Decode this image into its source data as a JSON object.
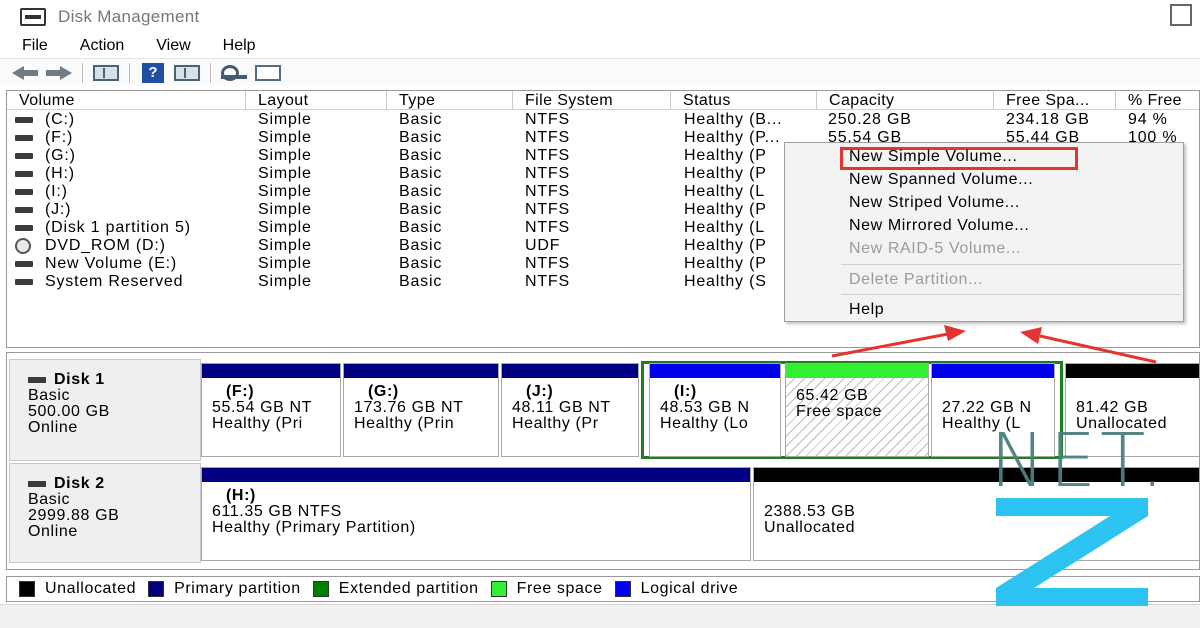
{
  "window": {
    "title": "Disk Management"
  },
  "menu": [
    "File",
    "Action",
    "View",
    "Help"
  ],
  "toolbar": {
    "buttons": [
      "back-arrow-icon",
      "forward-arrow-icon",
      "console-tree-icon",
      "help-icon",
      "properties-icon",
      "rescan-disks-icon",
      "list-view-icon"
    ],
    "help_glyph": "?"
  },
  "volume_table": {
    "columns": [
      "Volume",
      "Layout",
      "Type",
      "File System",
      "Status",
      "Capacity",
      "Free Spa...",
      "% Free"
    ],
    "rows": [
      {
        "volume": "(C:)",
        "layout": "Simple",
        "type": "Basic",
        "fs": "NTFS",
        "status": "Healthy (B...",
        "capacity": "250.28 GB",
        "free": "234.18 GB",
        "pct": "94 %"
      },
      {
        "volume": "(F:)",
        "layout": "Simple",
        "type": "Basic",
        "fs": "NTFS",
        "status": "Healthy (P...",
        "capacity": "55.54 GB",
        "free": "55.44 GB",
        "pct": "100 %"
      },
      {
        "volume": "(G:)",
        "layout": "Simple",
        "type": "Basic",
        "fs": "NTFS",
        "status": "Healthy (P",
        "capacity": "",
        "free": "",
        "pct": ""
      },
      {
        "volume": "(H:)",
        "layout": "Simple",
        "type": "Basic",
        "fs": "NTFS",
        "status": "Healthy (P",
        "capacity": "",
        "free": "",
        "pct": ""
      },
      {
        "volume": "(I:)",
        "layout": "Simple",
        "type": "Basic",
        "fs": "NTFS",
        "status": "Healthy (L",
        "capacity": "",
        "free": "",
        "pct": ""
      },
      {
        "volume": "(J:)",
        "layout": "Simple",
        "type": "Basic",
        "fs": "NTFS",
        "status": "Healthy (P",
        "capacity": "",
        "free": "",
        "pct": ""
      },
      {
        "volume": "(Disk 1 partition 5)",
        "layout": "Simple",
        "type": "Basic",
        "fs": "NTFS",
        "status": "Healthy (L",
        "capacity": "",
        "free": "",
        "pct": ""
      },
      {
        "volume": "DVD_ROM (D:)",
        "layout": "Simple",
        "type": "Basic",
        "fs": "UDF",
        "status": "Healthy (P",
        "capacity": "",
        "free": "",
        "pct": ""
      },
      {
        "volume": "New Volume (E:)",
        "layout": "Simple",
        "type": "Basic",
        "fs": "NTFS",
        "status": "Healthy (P",
        "capacity": "",
        "free": "",
        "pct": ""
      },
      {
        "volume": "System Reserved",
        "layout": "Simple",
        "type": "Basic",
        "fs": "NTFS",
        "status": "Healthy (S",
        "capacity": "",
        "free": "",
        "pct": ""
      }
    ]
  },
  "context_menu": {
    "items": [
      {
        "label": "New Simple Volume...",
        "enabled": true,
        "highlighted": true
      },
      {
        "label": "New Spanned Volume...",
        "enabled": true
      },
      {
        "label": "New Striped Volume...",
        "enabled": true
      },
      {
        "label": "New Mirrored Volume...",
        "enabled": true
      },
      {
        "label": "New RAID-5 Volume...",
        "enabled": false
      },
      {
        "label": "Delete Partition...",
        "enabled": false
      },
      {
        "label": "Help",
        "enabled": true
      }
    ]
  },
  "disks": [
    {
      "name": "Disk 1",
      "type": "Basic",
      "size": "500.00 GB",
      "state": "Online",
      "partitions": [
        {
          "name": "(F:)",
          "line1": "55.54 GB NT",
          "line2": "Healthy (Pri",
          "kind": "primary"
        },
        {
          "name": "(G:)",
          "line1": "173.76 GB NT",
          "line2": "Healthy (Prin",
          "kind": "primary"
        },
        {
          "name": "(J:)",
          "line1": "48.11 GB NT",
          "line2": "Healthy (Pr",
          "kind": "primary"
        },
        {
          "name": "(I:)",
          "line1": "48.53 GB N",
          "line2": "Healthy (Lo",
          "kind": "logical"
        },
        {
          "name": "",
          "line1": "65.42 GB",
          "line2": "Free space",
          "kind": "free"
        },
        {
          "name": "",
          "line1": "27.22 GB N",
          "line2": "Healthy (L",
          "kind": "logical"
        },
        {
          "name": "",
          "line1": "81.42 GB",
          "line2": "Unallocated",
          "kind": "unallocated"
        }
      ]
    },
    {
      "name": "Disk 2",
      "type": "Basic",
      "size": "2999.88 GB",
      "state": "Online",
      "partitions": [
        {
          "name": "(H:)",
          "line1": "611.35 GB NTFS",
          "line2": "Healthy (Primary Partition)",
          "kind": "primary"
        },
        {
          "name": "",
          "line1": "2388.53 GB",
          "line2": "Unallocated",
          "kind": "unallocated"
        }
      ]
    }
  ],
  "legend": [
    {
      "label": "Unallocated",
      "color": "#000000"
    },
    {
      "label": "Primary partition",
      "color": "#000080"
    },
    {
      "label": "Extended partition",
      "color": "#008000"
    },
    {
      "label": "Free space",
      "color": "#33ee33"
    },
    {
      "label": "Logical drive",
      "color": "#0000ff"
    }
  ],
  "colors": {
    "primary": "#000080",
    "logical": "#0000ee",
    "free": "#33ee33",
    "unallocated": "#000000",
    "extended": "#1d7f1d",
    "highlight": "#e3342f",
    "watermark_net": "#4d7f7f",
    "watermark_z": "#2ec4f2"
  },
  "watermark": {
    "text": "NET.",
    "letter": "Z"
  }
}
